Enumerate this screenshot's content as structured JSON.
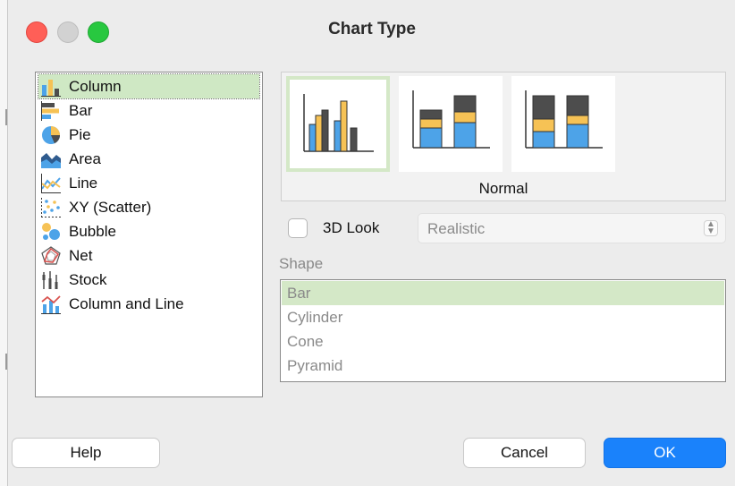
{
  "dialog": {
    "title": "Chart Type"
  },
  "chart_types": [
    {
      "label": "Column",
      "icon": "column-chart-icon",
      "selected": true
    },
    {
      "label": "Bar",
      "icon": "bar-chart-icon",
      "selected": false
    },
    {
      "label": "Pie",
      "icon": "pie-chart-icon",
      "selected": false
    },
    {
      "label": "Area",
      "icon": "area-chart-icon",
      "selected": false
    },
    {
      "label": "Line",
      "icon": "line-chart-icon",
      "selected": false
    },
    {
      "label": "XY (Scatter)",
      "icon": "scatter-chart-icon",
      "selected": false
    },
    {
      "label": "Bubble",
      "icon": "bubble-chart-icon",
      "selected": false
    },
    {
      "label": "Net",
      "icon": "net-chart-icon",
      "selected": false
    },
    {
      "label": "Stock",
      "icon": "stock-chart-icon",
      "selected": false
    },
    {
      "label": "Column and Line",
      "icon": "column-and-line-chart-icon",
      "selected": false
    }
  ],
  "subtypes": {
    "caption": "Normal",
    "variants": [
      {
        "icon": "normal-column-icon",
        "selected": true
      },
      {
        "icon": "stacked-column-icon",
        "selected": false
      },
      {
        "icon": "percent-stacked-column-icon",
        "selected": false
      }
    ]
  },
  "look3d": {
    "label": "3D Look",
    "checked": false,
    "select_value": "Realistic"
  },
  "shape": {
    "label": "Shape",
    "items": [
      {
        "label": "Bar",
        "selected": true
      },
      {
        "label": "Cylinder",
        "selected": false
      },
      {
        "label": "Cone",
        "selected": false
      },
      {
        "label": "Pyramid",
        "selected": false
      }
    ]
  },
  "buttons": {
    "help": "Help",
    "cancel": "Cancel",
    "ok": "OK"
  },
  "colors": {
    "selection_green": "#cfe8c4",
    "ok_blue": "#1a82fb",
    "bar_blue": "#4da3e8",
    "bar_orange": "#f6c255",
    "bar_dark": "#4d4d4d"
  }
}
